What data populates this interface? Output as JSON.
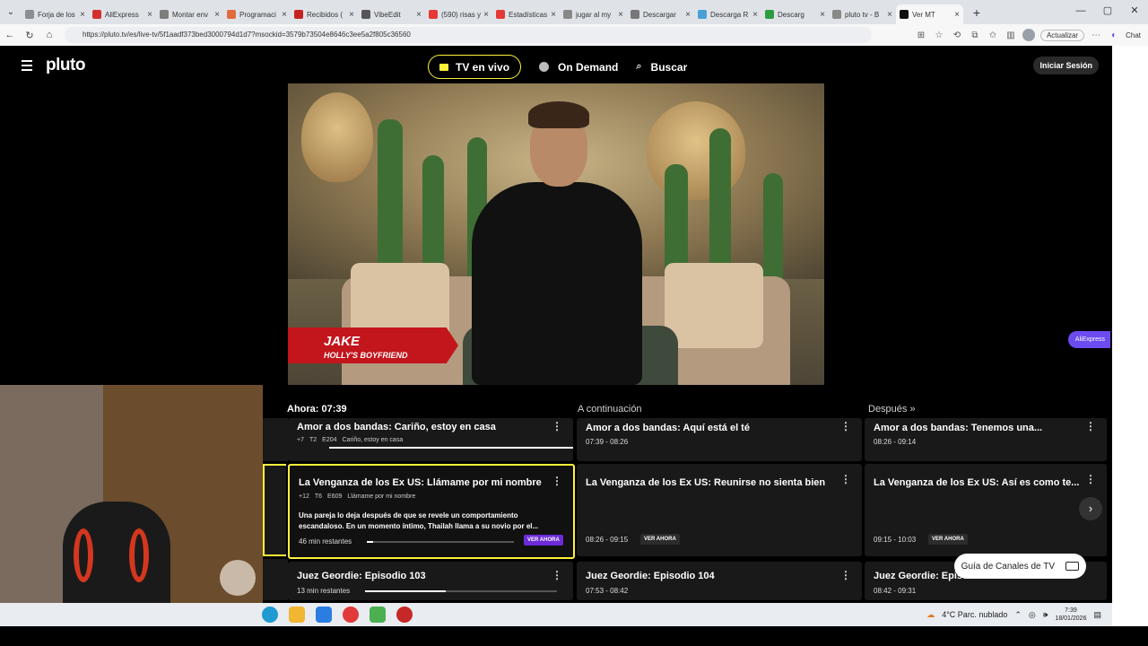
{
  "browser": {
    "tabs": [
      {
        "title": "Forja de los",
        "color": "#8a8f96"
      },
      {
        "title": "AliExpress",
        "color": "#d32f2f"
      },
      {
        "title": "Montar env",
        "color": "#7d7d7d"
      },
      {
        "title": "Programaci",
        "color": "#e06b3d"
      },
      {
        "title": "Recibidos (",
        "color": "#c5221f"
      },
      {
        "title": "VibeEdit",
        "color": "#555555"
      },
      {
        "title": "(590) risas y",
        "color": "#e53935"
      },
      {
        "title": "Estadísticas",
        "color": "#e53935"
      },
      {
        "title": "jugar al my",
        "color": "#888888"
      },
      {
        "title": "Descargar",
        "color": "#777777"
      },
      {
        "title": "Descarga R",
        "color": "#4aa0d6"
      },
      {
        "title": "Descarg",
        "color": "#2e9d3f"
      },
      {
        "title": "pluto tv - B",
        "color": "#888888"
      },
      {
        "title": "Ver MT",
        "color": "#111111"
      }
    ],
    "url": "https://pluto.tv/es/live-tv/5f1aadf373bed3000794d1d7?msockid=3579b73504e8646c3ee5a2f805c36560",
    "update_label": "Actualizar",
    "chat_label": "Chat"
  },
  "pluto": {
    "logo": "pluto",
    "nav": {
      "live": "TV en vivo",
      "on_demand": "On Demand",
      "search": "Buscar"
    },
    "login": "Iniciar Sesión",
    "aliexpress_badge": "AliExpress",
    "video": {
      "lower_third_name": "JAKE",
      "lower_third_sub": "HOLLY'S BOYFRIEND"
    },
    "guide": {
      "now_label": "Ahora: 07:39",
      "next_label": "A continuación",
      "later_label": "Después",
      "rows": [
        {
          "now": {
            "title": "Amor a dos bandas: Cariño, estoy en casa",
            "rating": "+7",
            "season": "T2",
            "episode": "E204",
            "episode_title": "Cariño, estoy en casa",
            "progress": 0.97
          },
          "next": {
            "title": "Amor a dos bandas: Aquí está el té",
            "time": "07:39 - 08:26"
          },
          "later": {
            "title": "Amor a dos bandas: Tenemos una...",
            "time": "08:26 - 09:14"
          }
        },
        {
          "now": {
            "title": "La Venganza de los Ex US: Llámame por mi nombre",
            "rating": "+12",
            "season": "T6",
            "episode": "E609",
            "episode_title": "Llámame por mi nombre",
            "description": "Una pareja lo deja después de que se revele un comportamiento escandaloso. En un momento íntimo, Thailah llama a su novio por el...",
            "remaining": "46 min restantes",
            "progress": 0.04,
            "watch": "VER AHORA"
          },
          "next": {
            "title": "La Venganza de los Ex US: Reunirse no sienta bien",
            "time": "08:26 - 09:15",
            "watch": "VER AHORA"
          },
          "later": {
            "title": "La Venganza de los Ex US: Así es como te...",
            "time": "09:15 - 10:03",
            "watch": "VER AHORA"
          }
        },
        {
          "now": {
            "title": "Juez Geordie: Episodio 103",
            "remaining": "13 min restantes",
            "progress": 0.42
          },
          "next": {
            "title": "Juez Geordie: Episodio 104",
            "time": "07:53 - 08:42"
          },
          "later": {
            "title": "Juez Geordie: Episodio 105",
            "time": "08:42 - 09:31"
          }
        }
      ],
      "channel_guide_button": "Guía de Canales de TV"
    }
  },
  "taskbar": {
    "weather": "4°C  Parc. nublado",
    "time": "7:39",
    "date": "18/01/2026"
  }
}
